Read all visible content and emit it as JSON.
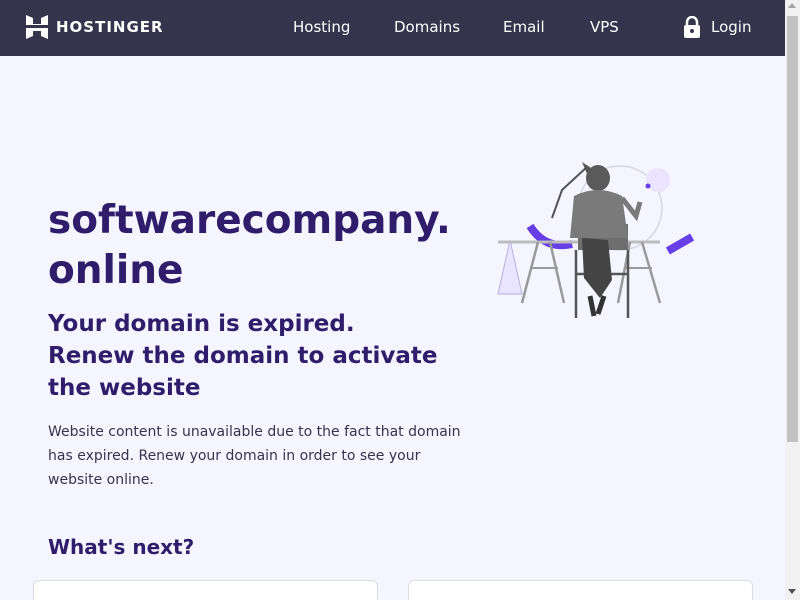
{
  "nav": {
    "logo_text": "HOSTINGER",
    "links": [
      {
        "label": "Hosting"
      },
      {
        "label": "Domains"
      },
      {
        "label": "Email"
      },
      {
        "label": "VPS"
      }
    ],
    "login_label": "Login"
  },
  "main": {
    "domain": "softwarecompany.online",
    "headline": "Your domain is expired. Renew the domain to activate the website",
    "description": "Website content is unavailable due to the fact that domain has expired. Renew your domain in order to see your website online.",
    "whats_next": "What's next?"
  },
  "icons": {
    "logo": "hostinger-logo-icon",
    "lock": "lock-icon",
    "illustration": "person-at-desk-illustration"
  },
  "colors": {
    "navbar_bg": "#36344d",
    "heading": "#2f1c6a",
    "accent": "#673de6",
    "page_bg": "#f4f5ff"
  }
}
